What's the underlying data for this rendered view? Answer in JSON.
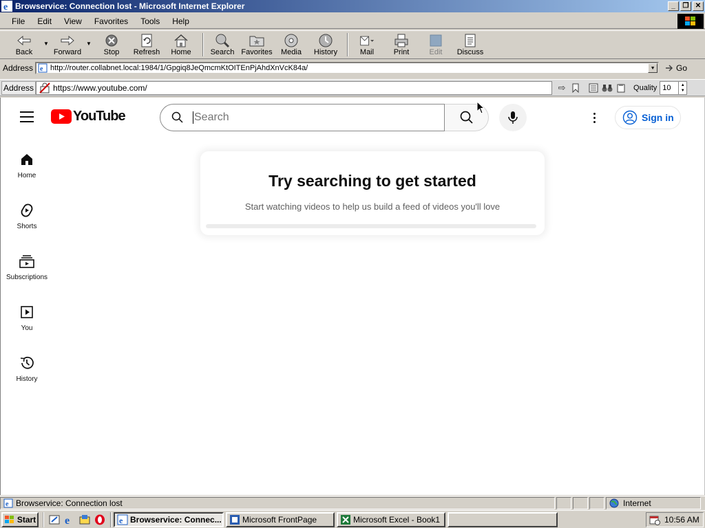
{
  "window": {
    "title": "Browservice: Connection lost - Microsoft Internet Explorer",
    "minimize_glyph": "_",
    "maximize_glyph": "❐",
    "close_glyph": "✕"
  },
  "menu": {
    "file": "File",
    "edit": "Edit",
    "view": "View",
    "favorites": "Favorites",
    "tools": "Tools",
    "help": "Help"
  },
  "toolbar": {
    "back": "Back",
    "forward": "Forward",
    "stop": "Stop",
    "refresh": "Refresh",
    "home": "Home",
    "search": "Search",
    "favorites": "Favorites",
    "media": "Media",
    "history": "History",
    "mail": "Mail",
    "print": "Print",
    "edit": "Edit",
    "discuss": "Discuss"
  },
  "address": {
    "label": "Address",
    "url": "http://router.collabnet.local:1984/1/Gpgiq8JeQmcmKtOITEnPjAhdXnVcK84a/",
    "go": "Go"
  },
  "proxy_bar": {
    "label": "Address",
    "url": "https://www.youtube.com/",
    "quality_label": "Quality",
    "quality_value": "10"
  },
  "youtube": {
    "logo_text": "YouTube",
    "search_placeholder": "Search",
    "sign_in": "Sign in",
    "guide": [
      {
        "label": "Home",
        "icon": "home-icon"
      },
      {
        "label": "Shorts",
        "icon": "shorts-icon"
      },
      {
        "label": "Subscriptions",
        "icon": "subscriptions-icon"
      },
      {
        "label": "You",
        "icon": "you-icon"
      },
      {
        "label": "History",
        "icon": "history-icon"
      }
    ],
    "feed_title": "Try searching to get started",
    "feed_subtitle": "Start watching videos to help us build a feed of videos you'll love"
  },
  "status": {
    "text": "Browservice: Connection lost",
    "zone": "Internet"
  },
  "taskbar": {
    "start": "Start",
    "tasks": [
      {
        "label": "Browservice: Connec...",
        "active": true
      },
      {
        "label": "Microsoft FrontPage",
        "active": false
      },
      {
        "label": "Microsoft Excel - Book1",
        "active": false
      }
    ],
    "clock": "10:56 AM"
  },
  "colors": {
    "titlebar_start": "#0a246a",
    "youtube_red": "#ff0000",
    "signin_blue": "#065fd4"
  }
}
